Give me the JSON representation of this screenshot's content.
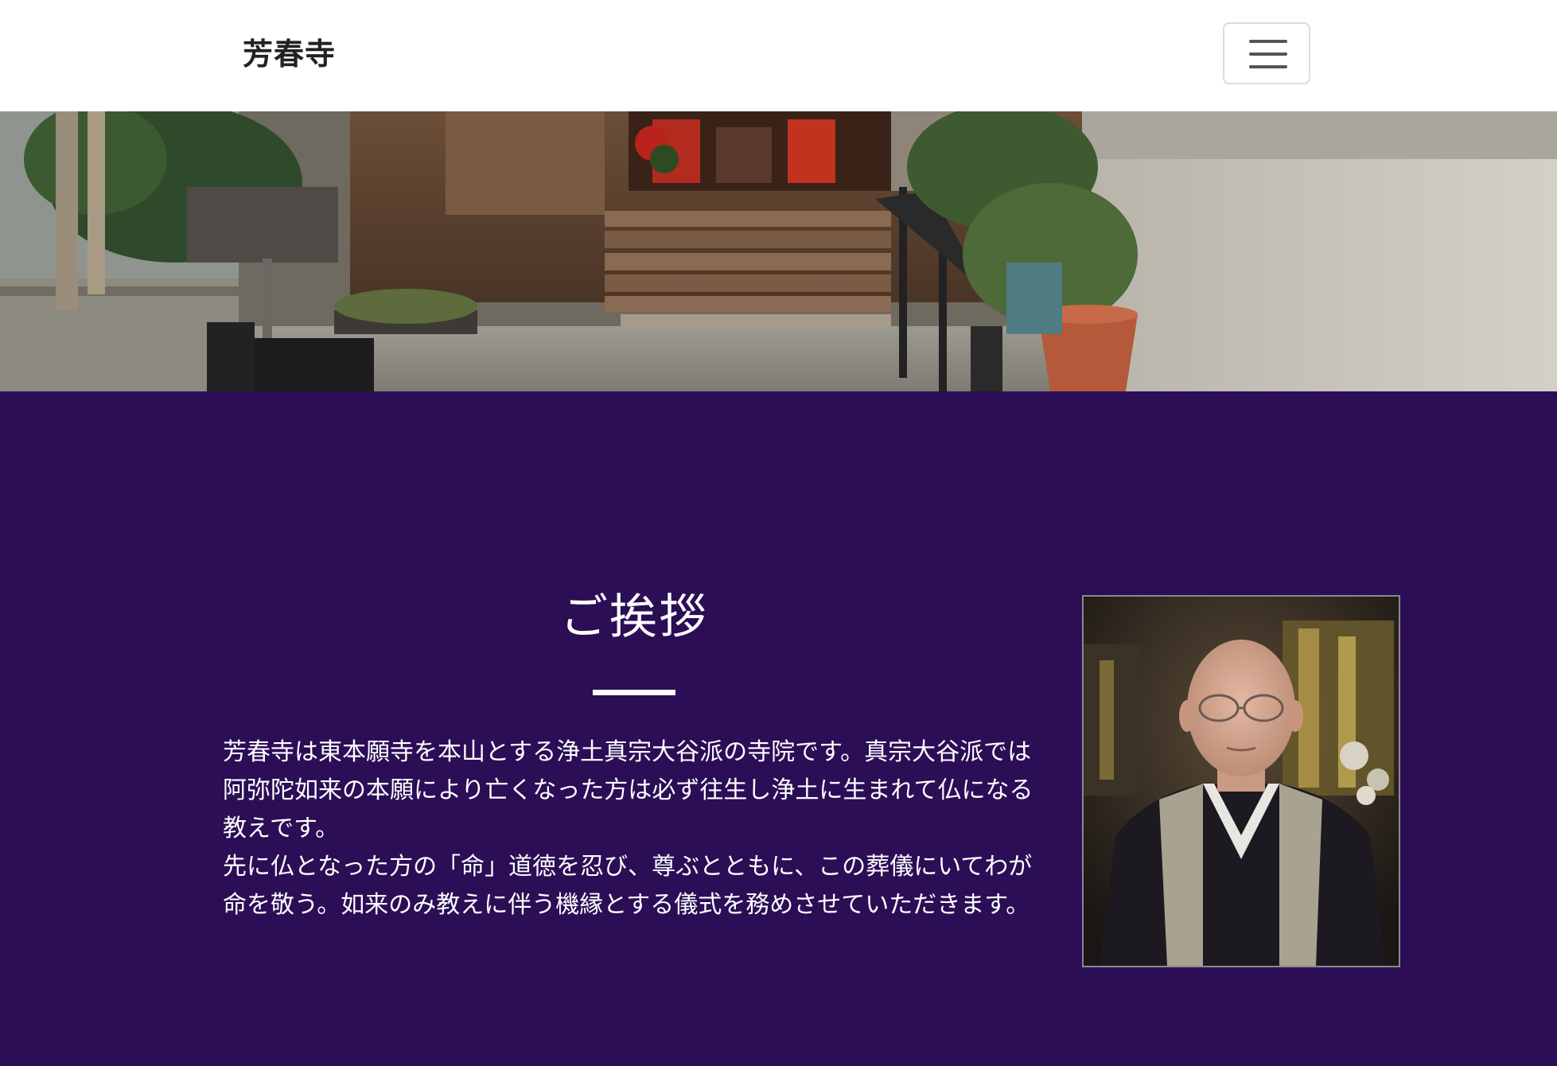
{
  "navbar": {
    "brand": "芳春寺",
    "menu_toggle_icon": "hamburger-icon"
  },
  "hero": {
    "image_alt": "temple entrance photo"
  },
  "greeting": {
    "title": "ご挨拶",
    "paragraphs": [
      "芳春寺は東本願寺を本山とする浄土真宗大谷派の寺院です。真宗大谷派では阿弥陀如来の本願により亡くなった方は必ず往生し浄土に生まれて仏になる教えです。",
      "先に仏となった方の「命」道徳を忍び、尊ぶとともに、この葬儀にいてわが命を敬う。如来のみ教えに伴う機縁とする儀式を務めさせていただきます。"
    ],
    "portrait_alt": "priest portrait photo"
  },
  "colors": {
    "section_background": "#2b0e56",
    "navbar_background": "#ffffff",
    "text_light": "#ffffff"
  }
}
